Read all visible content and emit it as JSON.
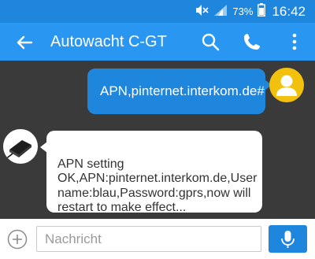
{
  "status": {
    "battery_percent": "73%",
    "time": "16:42"
  },
  "toolbar": {
    "title": "Autowacht C-GT"
  },
  "messages": {
    "outgoing": {
      "text": "APN,pinternet.interkom.de#"
    },
    "incoming": {
      "text": "APN setting\nOK,APN:pinternet.interkom.de,User\nname:blau,Password:gprs,now will\nrestart to make effect..."
    }
  },
  "composer": {
    "placeholder": "Nachricht"
  },
  "icons": {
    "mute": "mute-icon",
    "signal": "signal-icon",
    "battery": "battery-icon",
    "back": "back-arrow-icon",
    "search": "search-icon",
    "call": "phone-icon",
    "menu": "overflow-menu-icon",
    "add": "add-circle-icon",
    "mic": "microphone-icon"
  },
  "colors": {
    "status_bar": "#1f86dd",
    "toolbar": "#2996f2",
    "chat_bg": "#3a3a3a",
    "accent": "#1f86dd",
    "user_avatar": "#f2c10d"
  }
}
